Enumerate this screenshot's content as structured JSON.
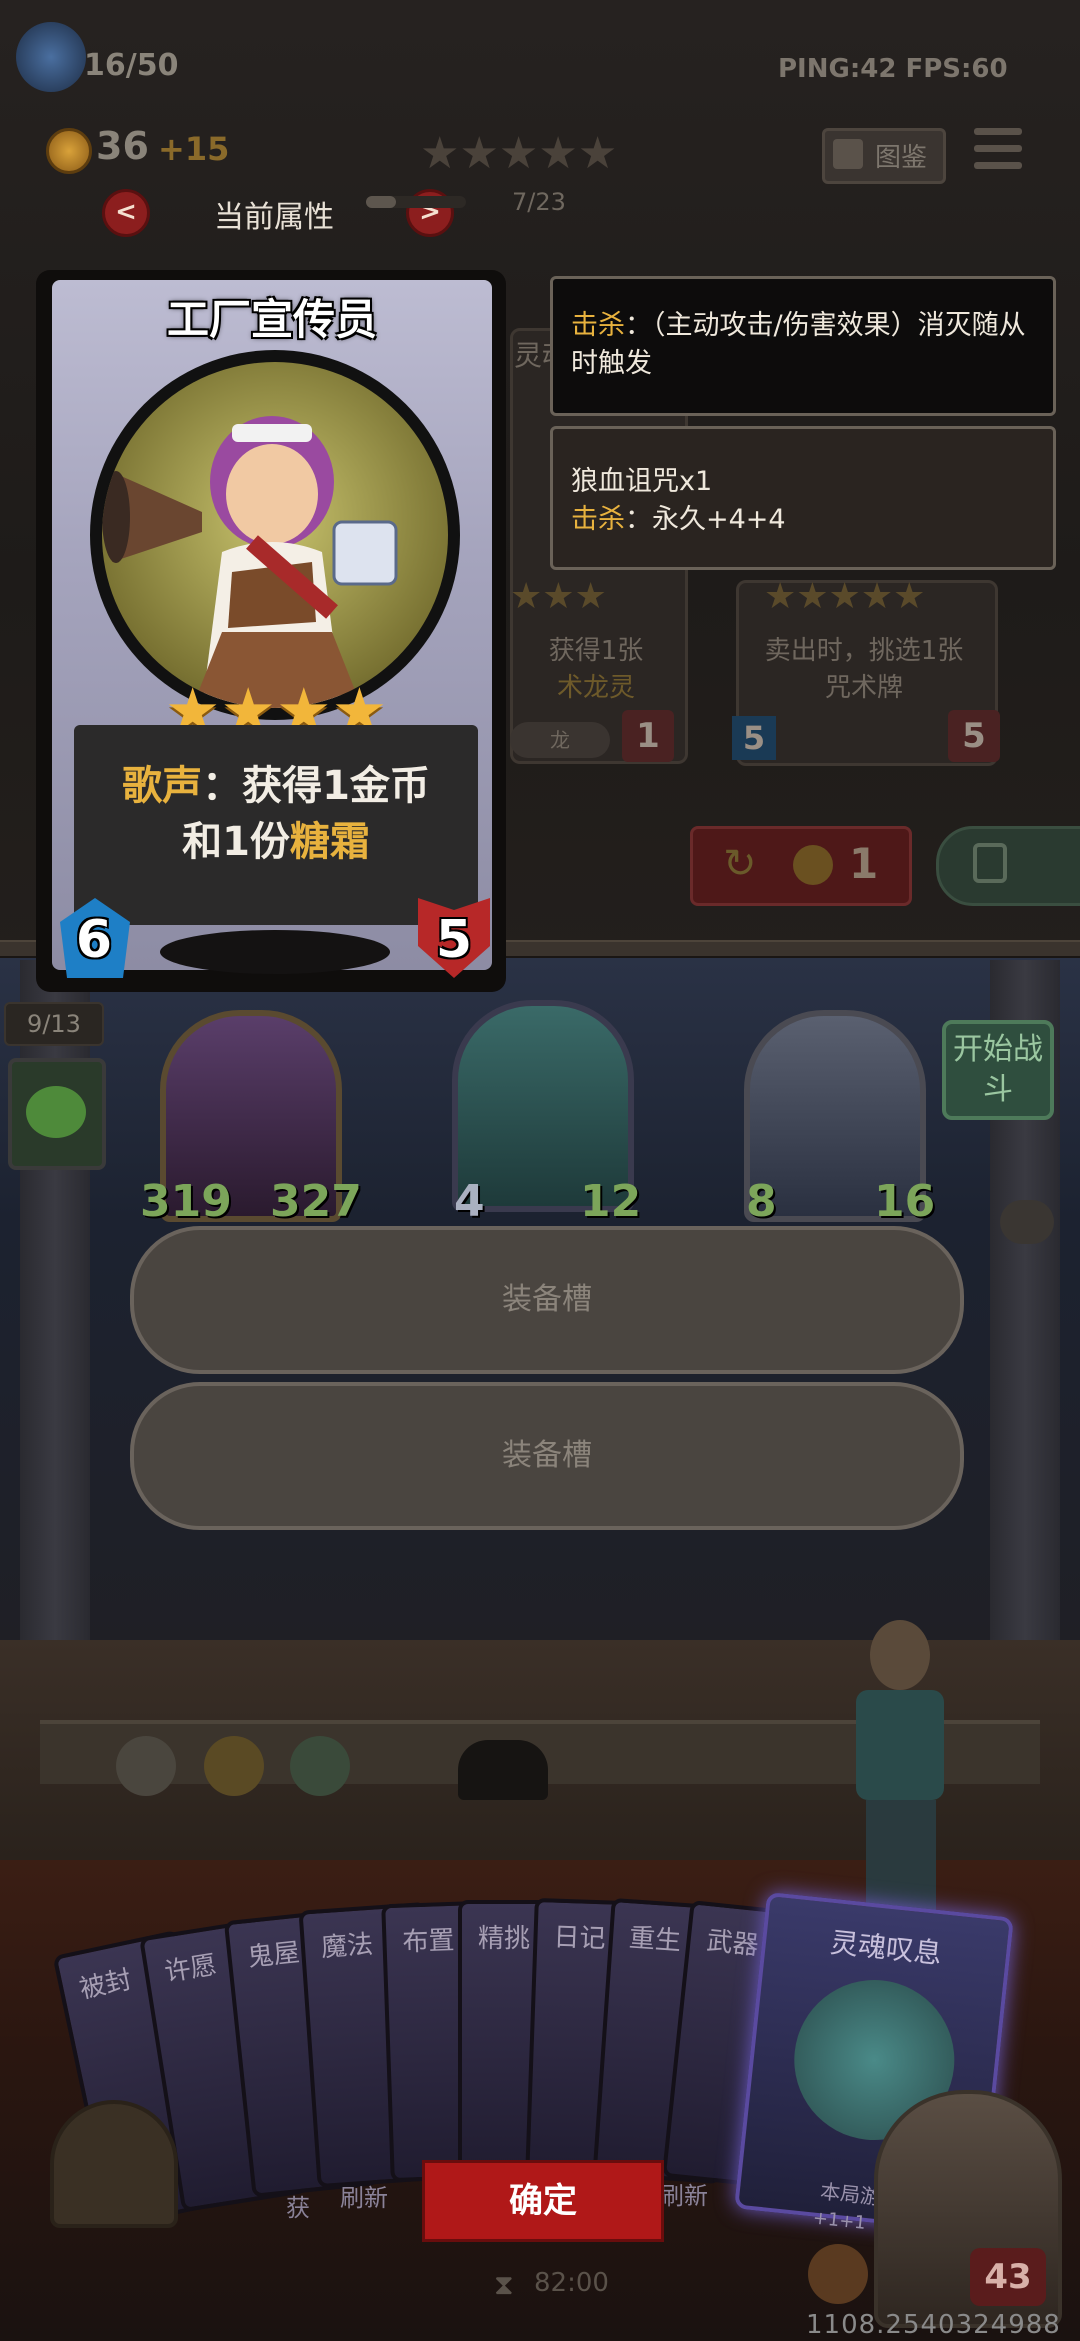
{
  "hud": {
    "population": "16/50",
    "ping_fps": "PING:42   FPS:60",
    "gold": "36",
    "gold_income": "+15",
    "codex_label": "图鉴",
    "progress": "7/23",
    "tier_stars": 5
  },
  "attr_nav": {
    "prev": "<",
    "title": "当前属性",
    "next": ">"
  },
  "card": {
    "name": "工厂宣传员",
    "stars": 4,
    "desc_keyword": "歌声",
    "desc_line1": "：获得1金币",
    "desc_line2_pre": "和1份",
    "desc_line2_key": "糖霜",
    "attack": "6",
    "health": "5"
  },
  "tooltip1": {
    "keyword": "击杀",
    "text": "：（主动攻击/伤害效果）消灭随从时触发"
  },
  "tooltip2": {
    "line1": "狼血诅咒x1",
    "line2_key": "击杀",
    "line2_text": "：永久+4+4"
  },
  "shop_bg": {
    "card1_text1": "获得1张",
    "card1_text2": "术龙灵",
    "card1_tag": "龙",
    "card1_health": "1",
    "card2_text1": "卖出时，挑选1张",
    "card2_text2": "咒术牌",
    "card2_attack": "5",
    "card2_health": "5",
    "refresh_cost": "1",
    "bg_card_title": "灵魂"
  },
  "board": {
    "side_counter": "9/13",
    "start_battle": "开始战斗",
    "units": [
      {
        "attack": "319",
        "health": "327"
      },
      {
        "attack": "4",
        "health": "12"
      },
      {
        "attack": "8",
        "health": "16"
      }
    ]
  },
  "slots": {
    "slot1": "装备槽",
    "slot2": "装备槽"
  },
  "hand": {
    "cards": [
      "被封",
      "许愿",
      "鬼屋",
      "魔法",
      "布置",
      "精挑",
      "日记",
      "重生",
      "武器"
    ],
    "featured_title": "灵魂叹息",
    "featured_footer": "本局游戏",
    "featured_footer2": "+1+1（阵",
    "peek1": "获",
    "peek2": "刷新",
    "peek3": "刷新"
  },
  "confirm_label": "确定",
  "timer": "82:00",
  "hero_health": "43",
  "coords": "1108.2540324988"
}
